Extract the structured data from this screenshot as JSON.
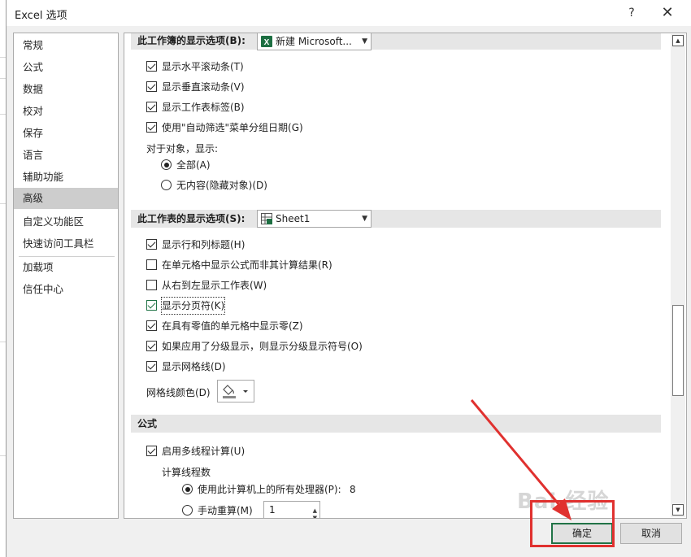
{
  "dialog": {
    "title": "Excel 选项",
    "help_glyph": "?",
    "close_glyph": "✕"
  },
  "nav": {
    "items": [
      {
        "label": "常规"
      },
      {
        "label": "公式"
      },
      {
        "label": "数据"
      },
      {
        "label": "校对"
      },
      {
        "label": "保存"
      },
      {
        "label": "语言"
      },
      {
        "label": "辅助功能"
      },
      {
        "label": "高级"
      },
      {
        "label": "自定义功能区"
      },
      {
        "label": "快速访问工具栏"
      },
      {
        "label": "加载项"
      },
      {
        "label": "信任中心"
      }
    ],
    "selected": "高级"
  },
  "workbook_section": {
    "heading": "此工作簿的显示选项(B):",
    "combo_value": "新建 Microsoft...",
    "options": [
      {
        "label": "显示水平滚动条(T)",
        "checked": true
      },
      {
        "label": "显示垂直滚动条(V)",
        "checked": true
      },
      {
        "label": "显示工作表标签(B)",
        "checked": true
      },
      {
        "label": "使用\"自动筛选\"菜单分组日期(G)",
        "checked": true
      }
    ],
    "objects_label": "对于对象，显示:",
    "objects_all": "全部(A)",
    "objects_none": "无内容(隐藏对象)(D)"
  },
  "worksheet_section": {
    "heading": "此工作表的显示选项(S):",
    "combo_value": "Sheet1",
    "options": [
      {
        "label": "显示行和列标题(H)",
        "checked": true
      },
      {
        "label": "在单元格中显示公式而非其计算结果(R)",
        "checked": false
      },
      {
        "label": "从右到左显示工作表(W)",
        "checked": false
      },
      {
        "label": "显示分页符(K)",
        "checked": true
      },
      {
        "label": "在具有零值的单元格中显示零(Z)",
        "checked": true
      },
      {
        "label": "如果应用了分级显示，则显示分级显示符号(O)",
        "checked": true
      },
      {
        "label": "显示网格线(D)",
        "checked": true
      }
    ],
    "gridline_color_label": "网格线颜色(D)"
  },
  "formula_section": {
    "heading": "公式",
    "multithread_label": "启用多线程计算(U)",
    "multithread_checked": true,
    "threads_label": "计算线程数",
    "use_all_label": "使用此计算机上的所有处理器(P):",
    "use_all_count": "8",
    "manual_label": "手动重算(M)",
    "manual_value": "1"
  },
  "buttons": {
    "ok": "确定",
    "cancel": "取消"
  },
  "watermark": "Bai 经验",
  "colors": {
    "accent": "#217346",
    "highlight": "#e0312f",
    "excel_icon": "#1d6f42"
  }
}
